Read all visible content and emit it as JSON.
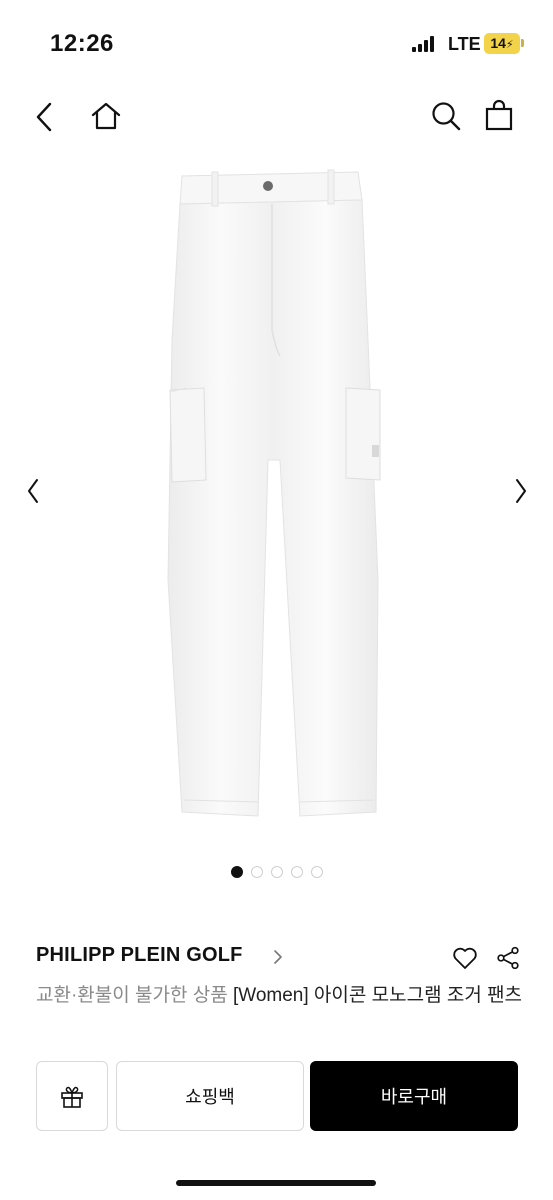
{
  "status_bar": {
    "time": "12:26",
    "network": "LTE",
    "battery": "14"
  },
  "nav": {
    "back_icon": "chevron-left-icon",
    "home_icon": "home-icon",
    "search_icon": "search-icon",
    "cart_icon": "shopping-bag-icon"
  },
  "gallery": {
    "image_alt": "white cargo jogger pants",
    "total_images": 5,
    "active_index": 0
  },
  "product": {
    "brand": "PHILIPP PLEIN GOLF",
    "tag": "교환·환불이 불가한 상품",
    "name": " [Women] 아이콘 모노그램 조거 팬츠"
  },
  "actions": {
    "gift_icon": "gift-icon",
    "shopping_bag_label": "쇼핑백",
    "buy_now_label": "바로구매"
  },
  "colors": {
    "accent": "#000000",
    "battery": "#f3d34a",
    "muted_text": "#8a8a8a"
  }
}
